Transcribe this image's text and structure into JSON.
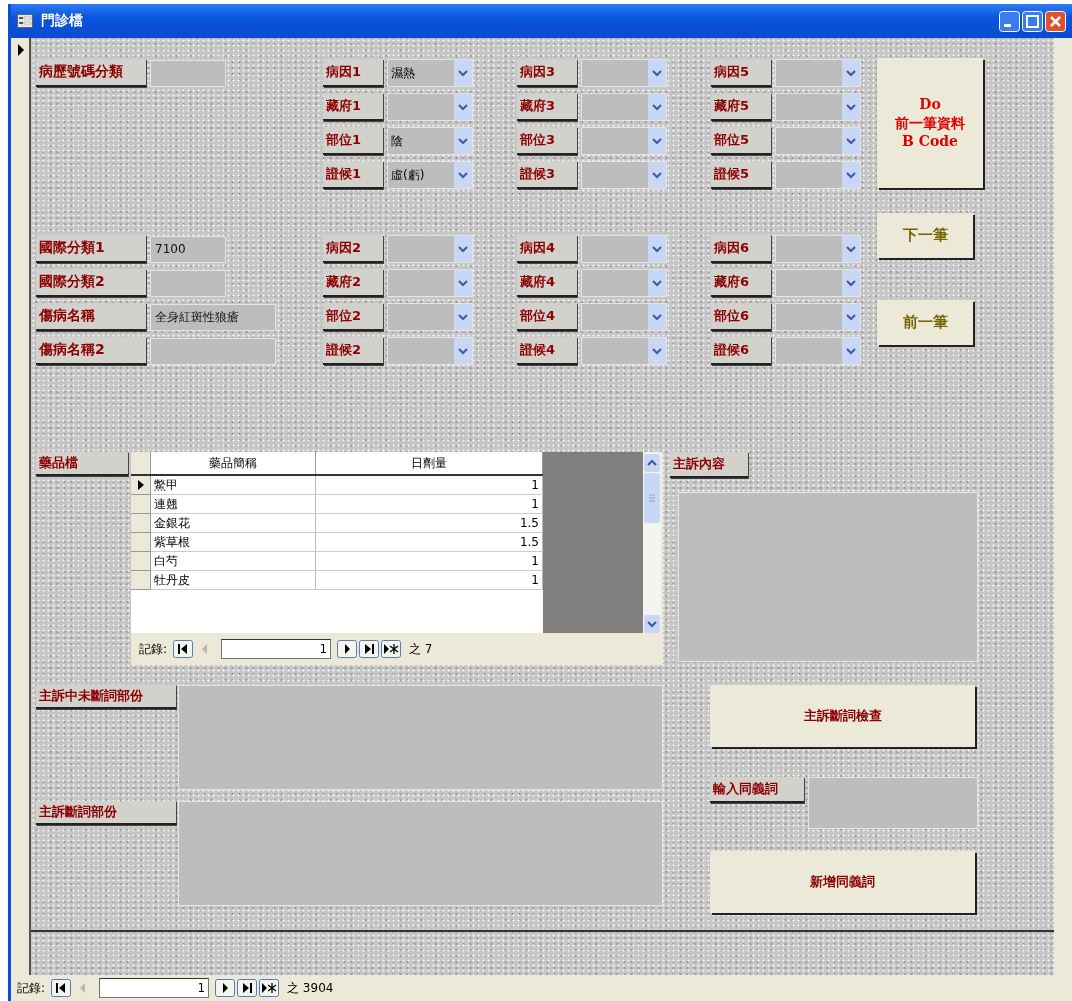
{
  "window": {
    "title": "門診檔"
  },
  "left_upper": [
    {
      "label": "病歷號碼分類"
    }
  ],
  "left_lower": [
    {
      "label": "國際分類1",
      "value": "7100",
      "wide": false
    },
    {
      "label": "國際分類2",
      "wide": false
    },
    {
      "label": "傷病名稱",
      "value": "全身紅斑性狼瘡",
      "wide": true
    },
    {
      "label": "傷病名稱2",
      "wide": true
    }
  ],
  "combo_columns": [
    {
      "upper": [
        {
          "label": "病因1",
          "value": "濕熱"
        },
        {
          "label": "藏府1"
        },
        {
          "label": "部位1",
          "value": "陰"
        },
        {
          "label": "證候1",
          "value": "虛(虧)"
        }
      ],
      "lower": [
        {
          "label": "病因2"
        },
        {
          "label": "藏府2"
        },
        {
          "label": "部位2"
        },
        {
          "label": "證候2"
        }
      ]
    },
    {
      "upper": [
        {
          "label": "病因3"
        },
        {
          "label": "藏府3"
        },
        {
          "label": "部位3"
        },
        {
          "label": "證候3"
        }
      ],
      "lower": [
        {
          "label": "病因4"
        },
        {
          "label": "藏府4"
        },
        {
          "label": "部位4"
        },
        {
          "label": "證候4"
        }
      ]
    },
    {
      "upper": [
        {
          "label": "病因5"
        },
        {
          "label": "藏府5"
        },
        {
          "label": "部位5"
        },
        {
          "label": "證候5"
        }
      ],
      "lower": [
        {
          "label": "病因6"
        },
        {
          "label": "藏府6"
        },
        {
          "label": "部位6"
        },
        {
          "label": "證候6"
        }
      ]
    }
  ],
  "side_buttons": [
    {
      "label": "Do\n前一筆資料\nB Code",
      "kind": "big"
    },
    {
      "label": "下一筆",
      "kind": "faint"
    },
    {
      "label": "前一筆",
      "kind": "faint"
    }
  ],
  "medicine": {
    "label": "藥品檔",
    "columns": [
      "藥品簡稱",
      "日劑量"
    ],
    "rows": [
      {
        "name": "鱉甲",
        "dose": "1",
        "selected": true
      },
      {
        "name": "連翹",
        "dose": "1",
        "selected": false
      },
      {
        "name": "金銀花",
        "dose": "1.5",
        "selected": false
      },
      {
        "name": "紫草根",
        "dose": "1.5",
        "selected": false
      },
      {
        "name": "白芍",
        "dose": "1",
        "selected": false
      },
      {
        "name": "牡丹皮",
        "dose": "1",
        "selected": false
      }
    ],
    "nav": {
      "label": "記錄:",
      "current": "1",
      "total": "之 7",
      "buttons": [
        {
          "kind": "first",
          "disabled": false
        },
        {
          "kind": "prev",
          "disabled": true
        },
        {
          "kind": "next",
          "disabled": false
        },
        {
          "kind": "last",
          "disabled": false
        },
        {
          "kind": "new",
          "disabled": false
        }
      ]
    }
  },
  "complaint": {
    "label": "主訴內容"
  },
  "unsegmented": {
    "label": "主訴中未斷詞部份"
  },
  "segmented": {
    "label": "主訴斷詞部份"
  },
  "check_button": "主訴斷詞檢查",
  "synonym": {
    "label": "輸入同義詞"
  },
  "add_button": "新增同義詞",
  "record_nav": {
    "label": "記錄:",
    "current": "1",
    "total": "之 3904",
    "buttons": [
      {
        "kind": "first",
        "disabled": false
      },
      {
        "kind": "prev",
        "disabled": true
      },
      {
        "kind": "next",
        "disabled": false
      },
      {
        "kind": "last",
        "disabled": false
      },
      {
        "kind": "new",
        "disabled": false
      }
    ]
  }
}
